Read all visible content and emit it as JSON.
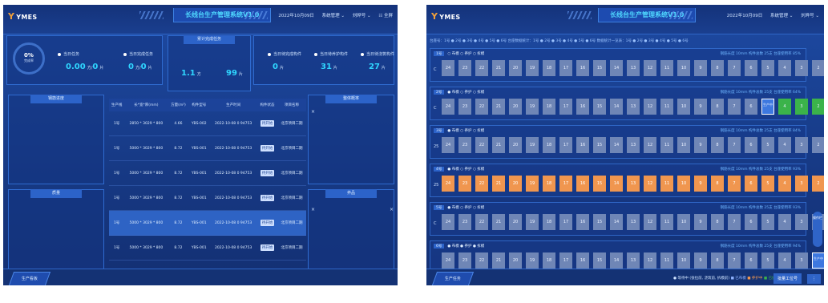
{
  "left": {
    "app": {
      "logo": "YMES",
      "title": "长线台生产管理系统V1.0"
    },
    "header": {
      "date": "2022年10月09日",
      "menu1": "系统管理 ⌄",
      "user": "刘晔号 ⌄",
      "action": "☷ 全屏"
    },
    "gauge": {
      "value": "0%",
      "label": "完成率"
    },
    "stats": [
      {
        "label": "当日任务",
        "value": "0.00",
        "unit": "方/",
        "value2": "0",
        "unit2": "片"
      },
      {
        "label": "当日完成任务",
        "value": "0",
        "unit": "方/",
        "value2": "0",
        "unit2": "片"
      },
      {
        "label": "累计完成任务",
        "value": "1.1",
        "unit": "方",
        "value2": "99",
        "unit2": "片"
      },
      {
        "label": "当日待完成构件",
        "value": "0",
        "unit": "片"
      },
      {
        "label": "当日待养护构件",
        "value": "31",
        "unit": "片"
      },
      {
        "label": "当日待浇筑构件",
        "value": "27",
        "unit": "片"
      }
    ],
    "panels": {
      "left_top": "钢筋进度",
      "left_bottom": "质量",
      "right_top": "整体概率",
      "right_bottom": "养品"
    },
    "table": {
      "headers": [
        "生产线",
        "长*宽*厚(mm)",
        "方量(m³)",
        "构件型号",
        "生产时间",
        "构件状态",
        "项目名称"
      ],
      "rows": [
        [
          "1号",
          "2850 * 3029 * 800",
          "4.66",
          "YBS-002",
          "2022-10-08 0 94753",
          "待开始",
          "北京项目二期"
        ],
        [
          "1号",
          "5000 * 3029 * 800",
          "8.72",
          "YBS-001",
          "2022-10-08 0 94753",
          "待开始",
          "北京项目二期"
        ],
        [
          "1号",
          "5000 * 3029 * 800",
          "8.72",
          "YBS-001",
          "2022-10-08 0 94753",
          "待开始",
          "北京项目二期"
        ],
        [
          "1号",
          "5000 * 3029 * 800",
          "8.72",
          "YBS-001",
          "2022-10-08 0 94753",
          "待开始",
          "北京项目二期"
        ],
        [
          "1号",
          "5000 * 3029 * 800",
          "8.72",
          "YBS-001",
          "2022-10-08 0 94753",
          "待开始",
          "北京项目二期"
        ],
        [
          "1号",
          "5000 * 3029 * 800",
          "8.72",
          "YBS-001",
          "2022-10-08 0 94753",
          "待开始",
          "北京项目二期"
        ],
        [
          "1号",
          "5000 * 3029 * 800",
          "8.72",
          "YBS-001",
          "2022-10-08 0 94753",
          "待开始",
          "北京项目二期"
        ]
      ]
    },
    "bottom_tab": "生产看板"
  },
  "right": {
    "app": {
      "logo": "YMES",
      "title": "长线台生产管理系统V1.0"
    },
    "header": {
      "date": "2022年10月09日",
      "menu1": "系统管理 ⌄",
      "user": "刘晔号 ⌄"
    },
    "legend": "台座号：1号 ● 2号 ● 3号 ● 4号 ● 5号 ● 6号   台座数据统计：1号 ● 2号 ● 3号 ● 4号 ● 5号 ● 6号   数据统计一览表：1号 ● 2号 ● 3号 ● 4号 ● 5号 ● 6号",
    "cell_numbers": [
      "24",
      "23",
      "22",
      "21",
      "20",
      "19",
      "18",
      "17",
      "16",
      "15",
      "14",
      "13",
      "12",
      "11",
      "10",
      "9",
      "8",
      "7",
      "6",
      "5",
      "4",
      "3",
      "2",
      "1"
    ],
    "lanes": [
      {
        "name": "1号",
        "status": "○ 布模 ○ 养护 ○ 拆模",
        "stat": "钢筋长度 10mm  构件总数 25支  台座使用率 85%",
        "left": "C",
        "style": "normal",
        "green": [],
        "selected": ""
      },
      {
        "name": "2号",
        "status": "● 布模 ○ 养护 ○ 拆模",
        "stat": "钢筋长度 10mm  构件总数 25支  台座使用率 64%",
        "left": "C",
        "style": "normal",
        "green": [
          "4",
          "3",
          "2",
          "1"
        ],
        "selected": "5"
      },
      {
        "name": "3号",
        "status": "● 布模 ○ 养护 ○ 拆模",
        "stat": "钢筋长度 10mm  构件总数 25支  台座使用率 84%",
        "left": "25",
        "style": "normal",
        "green": [],
        "selected": ""
      },
      {
        "name": "4号",
        "status": "● 布模 ○ 养护 ○ 拆模",
        "stat": "钢筋长度 10mm  构件总数 25支  台座使用率 93%",
        "left": "25",
        "style": "hot",
        "green": [
          "1"
        ],
        "selected": ""
      },
      {
        "name": "5号",
        "status": "● 布模 ○ 养护 ○ 拆模",
        "stat": "钢筋长度 10mm  构件总数 25支  台座使用率 93%",
        "left": "C",
        "style": "normal",
        "green": [],
        "selected": ""
      },
      {
        "name": "6号",
        "status": "● 布模 ● 养护 ● 拆模",
        "stat": "钢筋长度 10mm  构件总数 25支  台座使用率 94%",
        "left": "",
        "style": "normal",
        "green": [
          "1"
        ],
        "selected": "2"
      }
    ],
    "selected_label": "生产中",
    "bottom_legend": [
      "● 等待中 (张拉前, 浇筑前, 拆模前)",
      "■ 已布模",
      "■ 养护中",
      "■ 已拆模"
    ],
    "button": "批量工位号",
    "side_btn": "操作栏",
    "bottom_tab": "生产任务",
    "colors": {
      "bg": "#1a3f8f",
      "cell": "#6f86b6",
      "hot": "#f0964f",
      "green": "#3bb34a",
      "accent": "#2fd6ff"
    }
  }
}
